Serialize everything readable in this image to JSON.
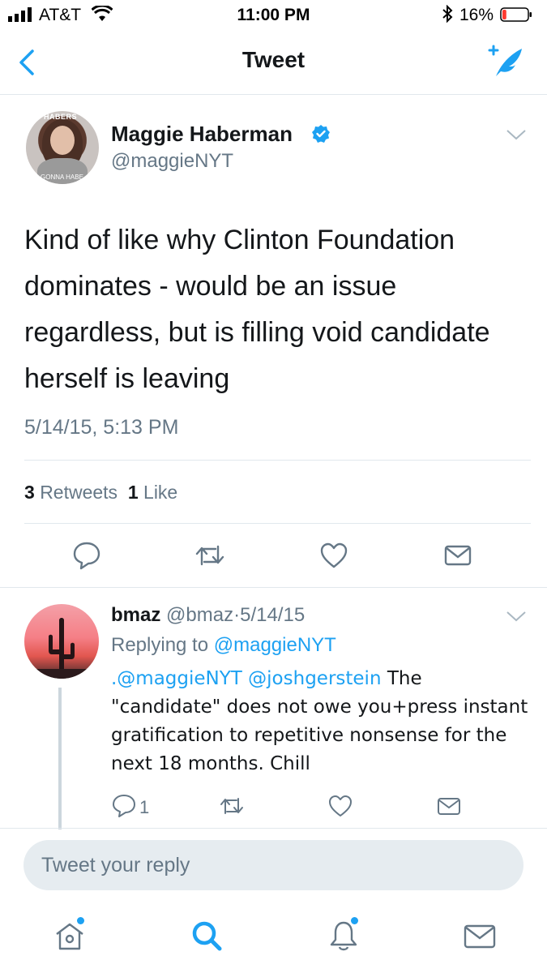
{
  "status_bar": {
    "carrier": "AT&T",
    "time": "11:00 PM",
    "battery_percent": "16%",
    "battery_level": 0.16,
    "icons": [
      "signal-icon",
      "wifi-icon",
      "bluetooth-icon",
      "battery-icon"
    ]
  },
  "nav": {
    "title": "Tweet",
    "back_icon": "chevron-left-icon",
    "compose_icon": "compose-tweet-icon"
  },
  "tweet": {
    "author_name": "Maggie Haberman",
    "author_handle": "@maggieNYT",
    "verified": true,
    "avatar_text_top": "HABERS",
    "avatar_text_bottom": "GONNA HABE",
    "text": "Kind of like why Clinton Foundation dominates - would be an issue regardless, but is filling void candidate herself is leaving",
    "timestamp": "5/14/15, 5:13 PM",
    "retweets_count": "3",
    "retweets_label": "Retweets",
    "likes_count": "1",
    "likes_label": "Like",
    "actions": [
      "reply-icon",
      "retweet-icon",
      "like-icon",
      "direct-message-icon"
    ]
  },
  "reply": {
    "author_name": "bmaz",
    "author_handle": "@bmaz",
    "separator": "·",
    "date": "5/14/15",
    "replying_prefix": "Replying to",
    "replying_to": "@maggieNYT",
    "mention1": ".@maggieNYT",
    "mention2": "@joshgerstein",
    "text": "The \"candidate\" does not owe you+press instant gratification to repetitive nonsense for the next 18 months. Chill",
    "reply_count": "1"
  },
  "reply_bar": {
    "placeholder": "Tweet your reply"
  },
  "tab_bar": {
    "tabs": [
      "home-icon",
      "search-icon",
      "notifications-icon",
      "messages-icon"
    ],
    "accent_color": "#1da1f2"
  },
  "colors": {
    "accent": "#1da1f2",
    "secondary_text": "#657786",
    "divider": "#e1e8ed"
  }
}
